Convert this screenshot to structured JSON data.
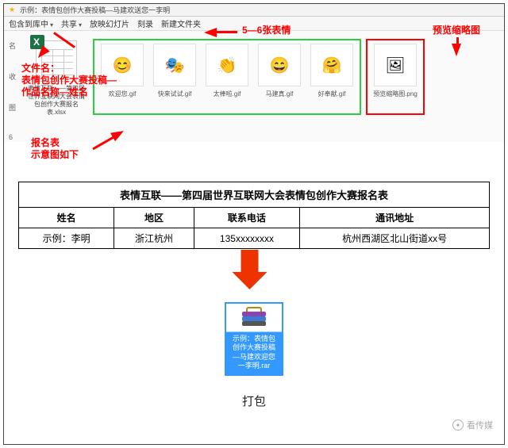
{
  "titlebar": {
    "path": "示例：表情包创作大赛投稿—马建欢送您一李明"
  },
  "ribbon": {
    "t1": "包含到库中",
    "t2": "共享",
    "t3": "放映幻灯片",
    "t4": "刻录",
    "t5": "新建文件夹"
  },
  "left": {
    "c1": "名",
    "c2": "收",
    "c3": "图",
    "c4": "6"
  },
  "anno": {
    "filename": "文件名：\n表情包创作大赛投稿—\n作品名称—姓名",
    "form": "报名表\n示意图如下",
    "count": "5—6张表情",
    "preview": "预览缩略图"
  },
  "excel_caption": "表情互联——第四届世界互联网大会表情包创作大赛报名表.xlsx",
  "thumbs": {
    "g1": {
      "cap": "欢迎您.gif",
      "ico": "😊"
    },
    "g2": {
      "cap": "快来试试.gif",
      "ico": "🎭"
    },
    "g3": {
      "cap": "太棒啦.gif",
      "ico": "👏"
    },
    "g4": {
      "cap": "马建真.gif",
      "ico": "😄"
    },
    "g5": {
      "cap": "好奉献.gif",
      "ico": "🤗"
    },
    "r1": {
      "cap": "预览缩略图.png",
      "ico": "🖼"
    }
  },
  "table": {
    "title": "表情互联——第四届世界互联网大会表情包创作大赛报名表",
    "h1": "姓名",
    "h2": "地区",
    "h3": "联系电话",
    "h4": "通讯地址",
    "r1c1": "示例：李明",
    "r1c2": "浙江杭州",
    "r1c3": "135xxxxxxxx",
    "r1c4": "杭州西湖区北山街道xx号"
  },
  "zip_caption": "示例：表情包创作大赛投稿—马建欢迎您一李明.rar",
  "daobao": "打包",
  "watermark": "看传媒"
}
